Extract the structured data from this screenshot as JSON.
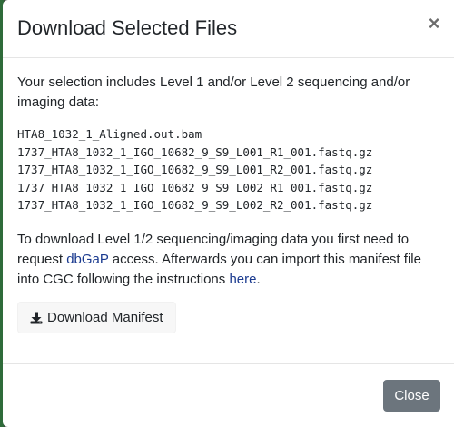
{
  "modal": {
    "title": "Download Selected Files",
    "close_symbol": "×"
  },
  "body": {
    "intro": "Your selection includes Level 1 and/or Level 2 sequencing and/or imaging data:",
    "files": [
      "HTA8_1032_1_Aligned.out.bam",
      "1737_HTA8_1032_1_IGO_10682_9_S9_L001_R1_001.fastq.gz",
      "1737_HTA8_1032_1_IGO_10682_9_S9_L001_R2_001.fastq.gz",
      "1737_HTA8_1032_1_IGO_10682_9_S9_L002_R1_001.fastq.gz",
      "1737_HTA8_1032_1_IGO_10682_9_S9_L002_R2_001.fastq.gz"
    ],
    "instructions": {
      "part1": "To download Level 1/2 sequencing/imaging data you first need to request ",
      "link_dbgap": "dbGaP",
      "part2": " access. Afterwards you can import this manifest file into CGC following the instructions ",
      "link_here": "here",
      "part3": "."
    }
  },
  "actions": {
    "download_manifest_label": "Download Manifest",
    "download_icon": "download-icon",
    "close_label": "Close"
  },
  "colors": {
    "link": "#1a3a8f",
    "close_button": "#6c757d"
  }
}
